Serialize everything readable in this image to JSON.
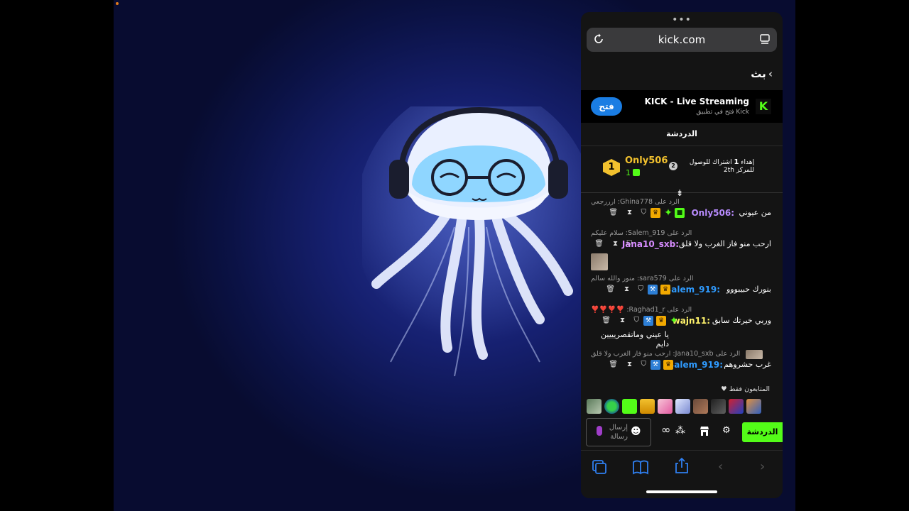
{
  "browser": {
    "url": "kick.com",
    "back_label": "بث"
  },
  "app_banner": {
    "title": "KICK - Live Streaming",
    "subtitle": "فتح في تطبيق Kick",
    "open_button": "فتح",
    "logo_letter": "K"
  },
  "chat": {
    "header": "الدردشة",
    "pinned": {
      "rank": "1",
      "username": "Only506",
      "gift_count": "1",
      "badge_number": "2",
      "text_pre": "إهداء ",
      "text_bold": "1",
      "text_post": " اشتراك للوصول للمركز 2",
      "text_suffix": "th"
    },
    "messages": [
      {
        "reply": "الرد على Ghina778: ارررجعي",
        "username": "Only506:",
        "username_color": "#b98cff",
        "text": "من عيوني",
        "continuation": ""
      },
      {
        "reply": "الرد على Salem_919: سلام عليكم",
        "username": "Jana10_sxb:",
        "username_color": "#d78cff",
        "text": "ارحب منو فاز الغرب ولا قلق",
        "continuation": ""
      },
      {
        "reply": "الرد على sara579: منور والله سالم",
        "username": "Salem_919:",
        "username_color": "#2f9bff",
        "text": "بنورك حبيبووو",
        "continuation": ""
      },
      {
        "reply": "الرد على Raghad1_r: ❣️❣️❣️❣️",
        "username": "wajn11:",
        "username_color": "#fff36b",
        "text": "وربي خيرتك سابق",
        "continuation": "يا عيني وماتقصريييين دايم"
      },
      {
        "reply": "الرد على Jana10_sxb: ارحب منو فاز الغرب ولا قلق",
        "username": "Salem_919:",
        "username_color": "#2f9bff",
        "text": "غرب حشروهم",
        "continuation": ""
      }
    ],
    "followers_only": "المتابعون فقط",
    "input_placeholder": "إرسال رسالة",
    "chat_button": "الدردشة"
  },
  "colors": {
    "kick_green": "#53fc18",
    "safari_blue": "#2f7ff0"
  },
  "icons": {
    "reload": "reload-icon",
    "reader": "reader-icon",
    "tabs": "tabs-icon",
    "bookmarks": "bookmarks-icon",
    "share": "share-icon"
  }
}
